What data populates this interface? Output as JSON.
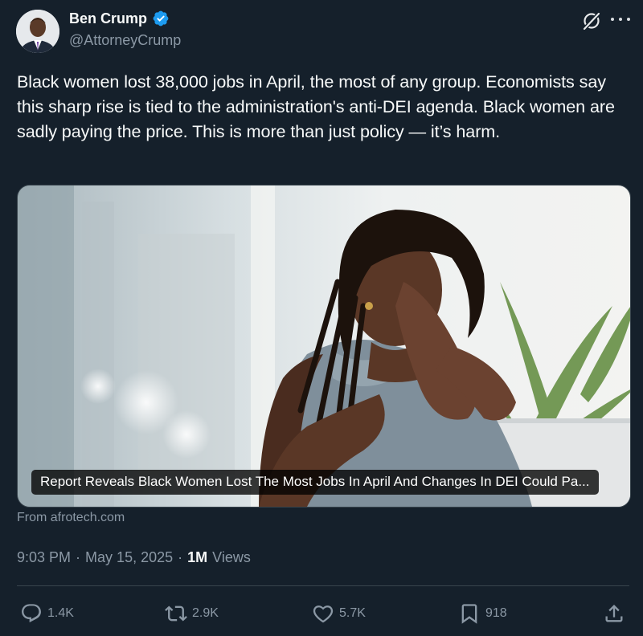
{
  "author": {
    "display_name": "Ben Crump",
    "handle": "@AttorneyCrump",
    "verified": true,
    "avatar_icon": "profile-photo"
  },
  "header_icons": [
    "grok-icon",
    "more-icon"
  ],
  "tweet": {
    "text": "Black women lost 38,000 jobs in April, the most of any group. Economists say this sharp rise is tied to the administration's anti-DEI agenda. Black women are sadly paying the price. This is more than just policy — it’s harm."
  },
  "card": {
    "caption": "Report Reveals Black Women Lost The Most Jobs In April And Changes In DEI Could Pa...",
    "source": "From afrotech.com"
  },
  "meta": {
    "time": "9:03 PM",
    "separator": "·",
    "date": "May 15, 2025",
    "views_count": "1M",
    "views_label": "Views"
  },
  "actions": {
    "replies": "1.4K",
    "reposts": "2.9K",
    "likes": "5.7K",
    "bookmarks": "918"
  },
  "colors": {
    "background": "#15202b",
    "text": "#f7f9f9",
    "secondary_text": "#8b98a5",
    "verified_blue": "#1d9bf0",
    "divider": "#38444d"
  }
}
